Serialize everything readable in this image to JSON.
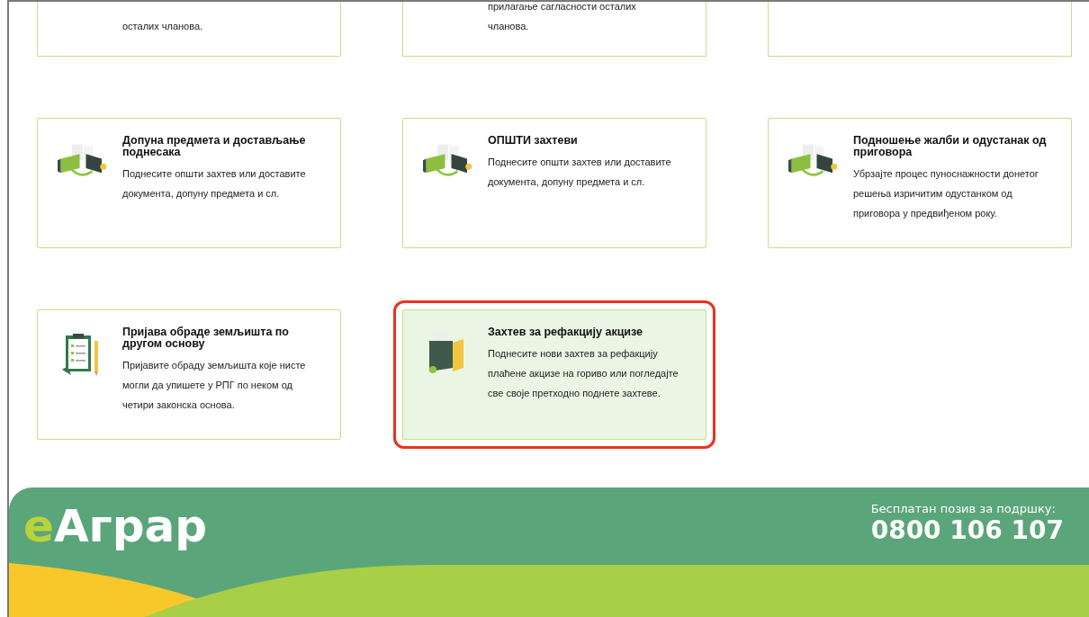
{
  "top_row": [
    {
      "description": "осталих чланова."
    },
    {
      "description": "прилагање сагласности осталих чланова."
    }
  ],
  "cards": [
    {
      "title": "Допуна предмета и достављање поднесака",
      "description": "Поднесите општи захтев или доставите документа, допуну предмета и сл.",
      "kind": "exchange",
      "selected": false
    },
    {
      "title": "ОПШТИ захтеви",
      "description": "Поднесите општи захтев или доставите документа, допуну предмета и сл.",
      "kind": "exchange",
      "selected": false
    },
    {
      "title": "Подношење жалби и одустанак од приговора",
      "description": "Убрзајте процес пуноснажности донетог решења изричитим одустанком од приговора у предвиђеном року.",
      "kind": "exchange",
      "selected": false
    },
    {
      "title": "Пријава обраде земљишта по другом основу",
      "description": "Пријавите обраду земљишта које нисте могли да упишете у РПГ по неком од четири законска основа.",
      "kind": "clipboard",
      "selected": false
    },
    {
      "title": "Захтев за рефакцију акцизе",
      "description": "Поднесите нови захтев за рефакцију плаћене акцизе на гориво или погледајте све своје претходно поднете захтеве.",
      "kind": "folder",
      "selected": true
    }
  ],
  "footer": {
    "logo_prefix": "e",
    "logo_name": "Аграр",
    "support_label": "Бесплатан позив за подршку:",
    "phone": "0800 106 107"
  }
}
